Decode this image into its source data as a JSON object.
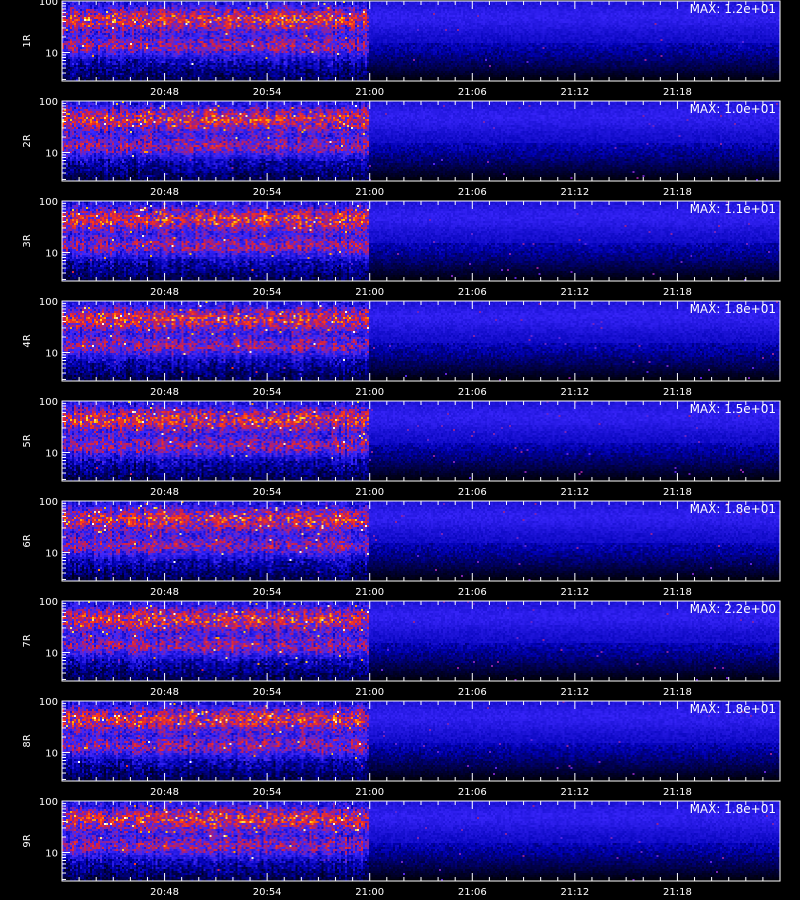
{
  "chart_data": {
    "type": "heatmap",
    "colors": {
      "background": "#000000",
      "axes": "#ffffff",
      "text": "#ffffff",
      "colormap": [
        "#000000",
        "#0000b4",
        "#3c28ff",
        "#c81e50",
        "#ff3c14",
        "#ffc800",
        "#ffffff"
      ]
    },
    "x_tick_labels": [
      "20:48",
      "20:54",
      "21:00",
      "21:06",
      "21:12",
      "21:18"
    ],
    "y_tick_labels": [
      "10",
      "100"
    ],
    "y_scale": "log",
    "x_axis_title": "",
    "data_gap_starts_at": "21:00",
    "panels": [
      {
        "label": "1R",
        "max_label": "MAX: 1.2e+01"
      },
      {
        "label": "2R",
        "max_label": "MAX: 1.0e+01"
      },
      {
        "label": "3R",
        "max_label": "MAX: 1.1e+01"
      },
      {
        "label": "4R",
        "max_label": "MAX: 1.8e+01"
      },
      {
        "label": "5R",
        "max_label": "MAX: 1.5e+01"
      },
      {
        "label": "6R",
        "max_label": "MAX: 1.8e+01"
      },
      {
        "label": "7R",
        "max_label": "MAX: 2.2e+00"
      },
      {
        "label": "8R",
        "max_label": "MAX: 1.8e+01"
      },
      {
        "label": "9R",
        "max_label": "MAX: 1.8e+01"
      }
    ]
  }
}
